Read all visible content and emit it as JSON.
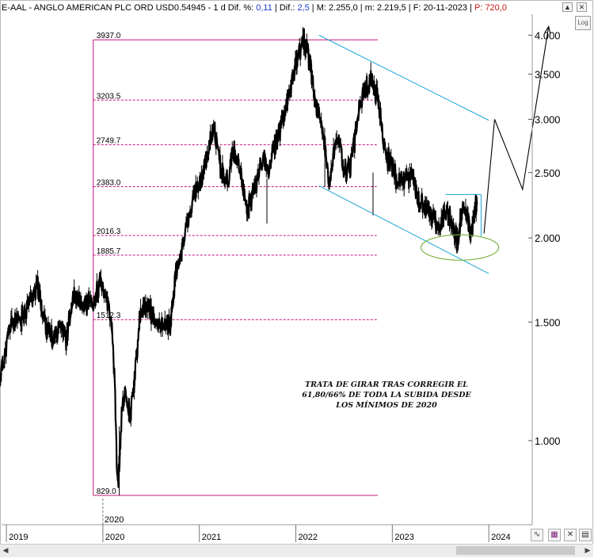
{
  "header": {
    "ticker": "E-AAL",
    "name": "ANGLO AMERICAN PLC ORD USD0.54945",
    "period": "1 d",
    "dif_pct_label": "Dif. %:",
    "dif_pct_value": "0,11",
    "dif_label": "Dif.:",
    "dif_value": "2,5",
    "max_label": "M:",
    "max_value": "2.255,0",
    "min_label": "m:",
    "min_value": "2.219,5",
    "date_label": "F:",
    "date_value": "20-11-2023",
    "price_label": "P:",
    "price_value": "720,0"
  },
  "controls": {
    "log_label": "Log",
    "prev_icon": "up-arrow-icon",
    "save_icon": "save-icon",
    "close_icon": "close-icon"
  },
  "colors": {
    "fib_lines": "#c8147d",
    "channel": "#1ea6d6",
    "ellipse": "#7cb342",
    "candles": "#000000",
    "dif_text": "#1a3cc8",
    "price_text": "#c81818"
  },
  "chart_data": {
    "type": "line",
    "scale": "log",
    "ylim": [
      750,
      4250
    ],
    "y_ticks": [
      "4.000",
      "3.500",
      "3.000",
      "2.500",
      "2.000",
      "1.500",
      "1.000"
    ],
    "y_tick_values": [
      4000,
      3500,
      3000,
      2500,
      2000,
      1500,
      1000
    ],
    "x_ticks": [
      "2019",
      "2020",
      "2021",
      "2022",
      "2023",
      "2024"
    ],
    "x_tick_dates": [
      2019.0,
      2020.0,
      2021.0,
      2022.0,
      2023.0,
      2024.0
    ],
    "crosshair_label": "2020",
    "crosshair_date": 2020.0,
    "fibonacci_levels": [
      "3937.0",
      "3203.5",
      "2749.7",
      "2383.0",
      "2016.3",
      "1885.7",
      "1512.3",
      "829.0"
    ],
    "fibonacci_values": [
      3937.0,
      3203.5,
      2749.7,
      2383.0,
      2016.3,
      1885.7,
      1512.3,
      829.0
    ],
    "fib_box": {
      "start": 2019.9,
      "end": 2022.85
    },
    "price_series": {
      "name": "",
      "x": [
        2018.93,
        2019.05,
        2019.15,
        2019.25,
        2019.32,
        2019.4,
        2019.48,
        2019.55,
        2019.62,
        2019.7,
        2019.78,
        2019.85,
        2019.9,
        2019.97,
        2020.03,
        2020.08,
        2020.12,
        2020.15,
        2020.17,
        2020.2,
        2020.24,
        2020.28,
        2020.33,
        2020.38,
        2020.43,
        2020.48,
        2020.55,
        2020.62,
        2020.7,
        2020.75,
        2020.8,
        2020.85,
        2020.9,
        2020.95,
        2021.02,
        2021.08,
        2021.15,
        2021.22,
        2021.28,
        2021.35,
        2021.42,
        2021.5,
        2021.58,
        2021.65,
        2021.72,
        2021.8,
        2021.88,
        2021.95,
        2022.02,
        2022.08,
        2022.15,
        2022.2,
        2022.25,
        2022.28,
        2022.3,
        2022.35,
        2022.4,
        2022.45,
        2022.48,
        2022.52,
        2022.58,
        2022.65,
        2022.72,
        2022.78,
        2022.85,
        2022.92,
        2022.97,
        2023.02,
        2023.08,
        2023.14,
        2023.2,
        2023.28,
        2023.35,
        2023.42,
        2023.48,
        2023.55,
        2023.62,
        2023.68,
        2023.72,
        2023.78,
        2023.82,
        2023.86,
        2023.88
      ],
      "y": [
        1230,
        1500,
        1510,
        1620,
        1700,
        1500,
        1400,
        1500,
        1420,
        1640,
        1580,
        1610,
        1600,
        1710,
        1640,
        1530,
        1270,
        860,
        900,
        1130,
        1180,
        1090,
        1240,
        1500,
        1580,
        1580,
        1480,
        1500,
        1480,
        1760,
        1860,
        2050,
        2140,
        2350,
        2430,
        2650,
        2920,
        2550,
        2400,
        2700,
        2500,
        2200,
        2400,
        2600,
        2550,
        2800,
        3050,
        3350,
        3700,
        3930,
        3650,
        3200,
        3050,
        2850,
        2700,
        2380,
        2700,
        2800,
        2600,
        2500,
        2600,
        3100,
        3300,
        3450,
        3250,
        2700,
        2600,
        2500,
        2400,
        2450,
        2500,
        2250,
        2200,
        2150,
        2050,
        2200,
        2100,
        1960,
        2210,
        2150,
        2000,
        2240,
        2200
      ]
    },
    "channel": {
      "upper": {
        "x": [
          2022.24,
          2024.0
        ],
        "y": [
          4000,
          2990
        ]
      },
      "lower": {
        "x": [
          2022.24,
          2024.0
        ],
        "y": [
          2390,
          1770
        ]
      }
    },
    "projection": {
      "x": [
        2023.95,
        2024.06,
        2024.35,
        2024.62
      ],
      "y": [
        2030,
        3000,
        2360,
        4120
      ]
    },
    "support_box": {
      "x": [
        2023.55,
        2023.92
      ],
      "y": [
        2320,
        2010
      ]
    },
    "annotation": "TRATA DE GIRAR TRAS CORREGIR EL\n61,80/66% DE TODA LA SUBIDA DESDE\nLOS MÍNIMOS DE 2020"
  }
}
